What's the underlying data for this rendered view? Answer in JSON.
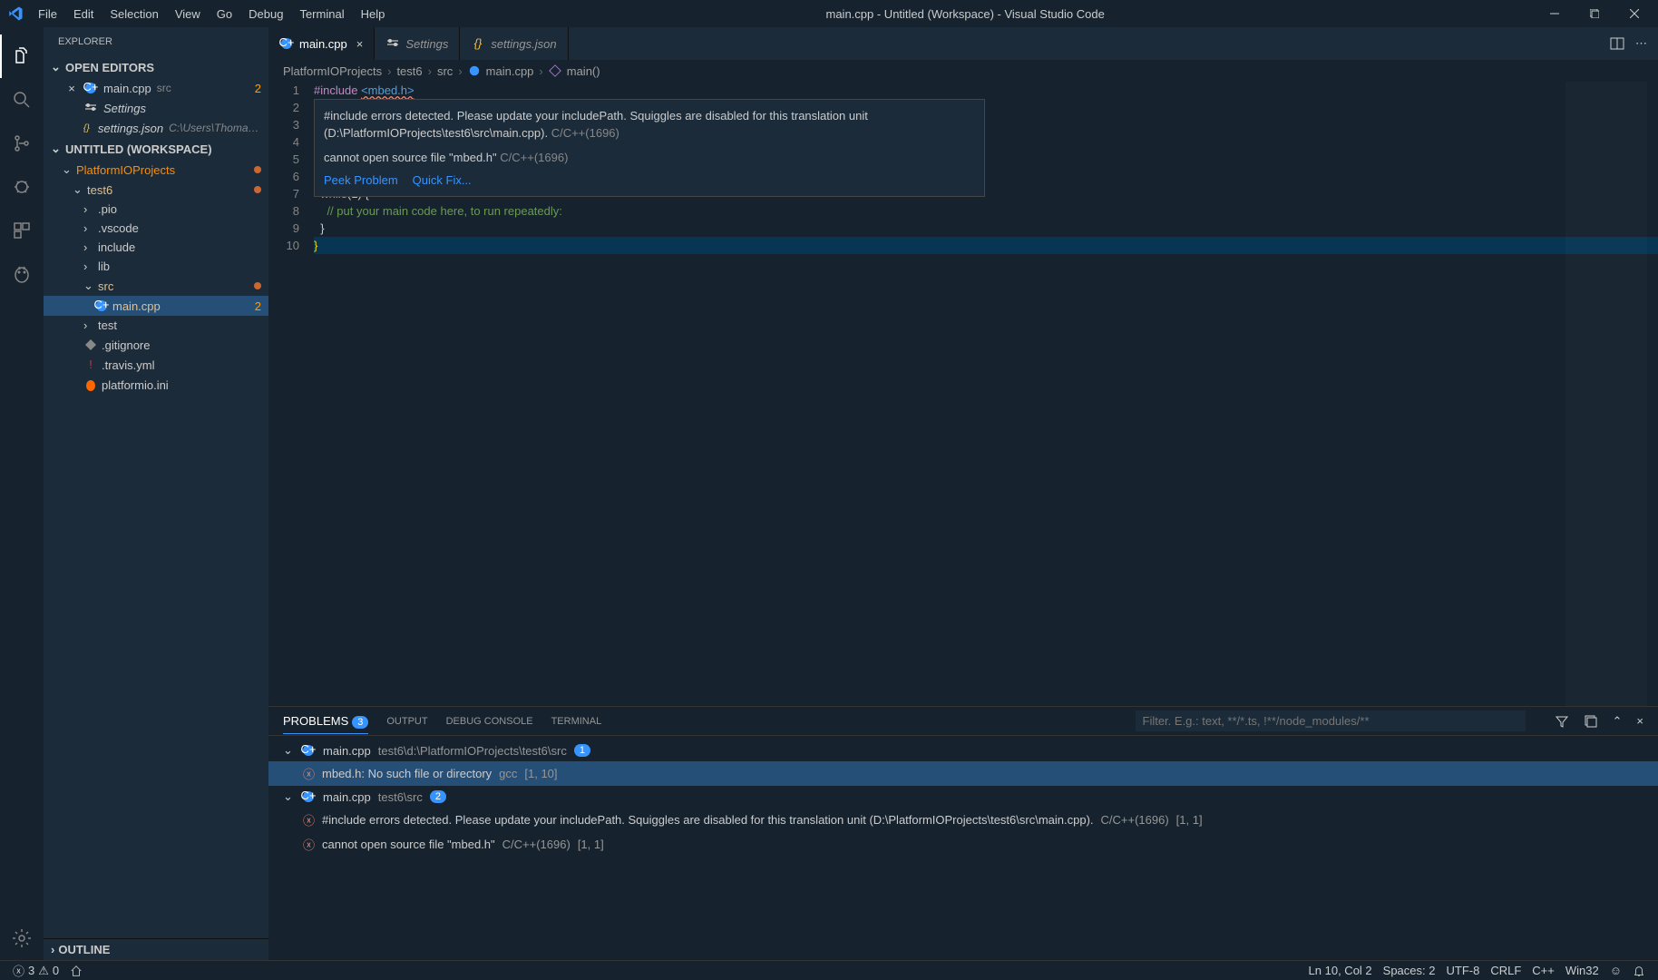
{
  "titlebar": {
    "title": "main.cpp - Untitled (Workspace) - Visual Studio Code",
    "menu": [
      "File",
      "Edit",
      "Selection",
      "View",
      "Go",
      "Debug",
      "Terminal",
      "Help"
    ]
  },
  "sidebar": {
    "header": "EXPLORER",
    "open_editors_label": "OPEN EDITORS",
    "open_editors": [
      {
        "name": "main.cpp",
        "path": "src",
        "badge": "2"
      },
      {
        "name": "Settings",
        "path": ""
      },
      {
        "name": "settings.json",
        "path": "C:\\Users\\Thomas\\App..."
      }
    ],
    "workspace_label": "UNTITLED (WORKSPACE)",
    "tree": {
      "root": "PlatformIOProjects",
      "project": "test6",
      "folders": [
        ".pio",
        ".vscode",
        "include",
        "lib"
      ],
      "src": "src",
      "src_file": "main.cpp",
      "src_badge": "2",
      "test": "test",
      "files": [
        ".gitignore",
        ".travis.yml",
        "platformio.ini"
      ]
    },
    "outline_label": "OUTLINE"
  },
  "tabs": [
    {
      "name": "main.cpp",
      "active": true
    },
    {
      "name": "Settings",
      "active": false
    },
    {
      "name": "settings.json",
      "active": false
    }
  ],
  "breadcrumb": [
    "PlatformIOProjects",
    "test6",
    "src",
    "main.cpp",
    "main()"
  ],
  "code": {
    "include": "#include",
    "header": "<mbed.h>",
    "while": "while",
    "one": "1",
    "brace_open": " {",
    "comment": "    // put your main code here, to run repeatedly:",
    "brace_close": "  }",
    "final_brace": "}"
  },
  "hover": {
    "msg1": "#include errors detected. Please update your includePath. Squiggles are disabled for this translation unit (D:\\PlatformIOProjects\\test6\\src\\main.cpp).",
    "src1": "C/C++(1696)",
    "msg2": "cannot open source file \"mbed.h\"",
    "src2": "C/C++(1696)",
    "peek": "Peek Problem",
    "quickfix": "Quick Fix..."
  },
  "panel": {
    "tabs": {
      "problems": "PROBLEMS",
      "count": "3",
      "output": "OUTPUT",
      "debug": "DEBUG CONSOLE",
      "terminal": "TERMINAL"
    },
    "filter_placeholder": "Filter. E.g.: text, **/*.ts, !**/node_modules/**",
    "groups": [
      {
        "file": "main.cpp",
        "path": "test6\\d:\\PlatformIOProjects\\test6\\src",
        "count": "1",
        "items": [
          {
            "msg": "mbed.h: No such file or directory",
            "src": "gcc",
            "loc": "[1, 10]"
          }
        ]
      },
      {
        "file": "main.cpp",
        "path": "test6\\src",
        "count": "2",
        "items": [
          {
            "msg": "#include errors detected. Please update your includePath. Squiggles are disabled for this translation unit (D:\\PlatformIOProjects\\test6\\src\\main.cpp).",
            "src": "C/C++(1696)",
            "loc": "[1, 1]"
          },
          {
            "msg": "cannot open source file \"mbed.h\"",
            "src": "C/C++(1696)",
            "loc": "[1, 1]"
          }
        ]
      }
    ]
  },
  "statusbar": {
    "errors": "3",
    "warnings": "0",
    "line_col": "Ln 10, Col 2",
    "spaces": "Spaces: 2",
    "encoding": "UTF-8",
    "eol": "CRLF",
    "lang": "C++",
    "platform": "Win32"
  }
}
